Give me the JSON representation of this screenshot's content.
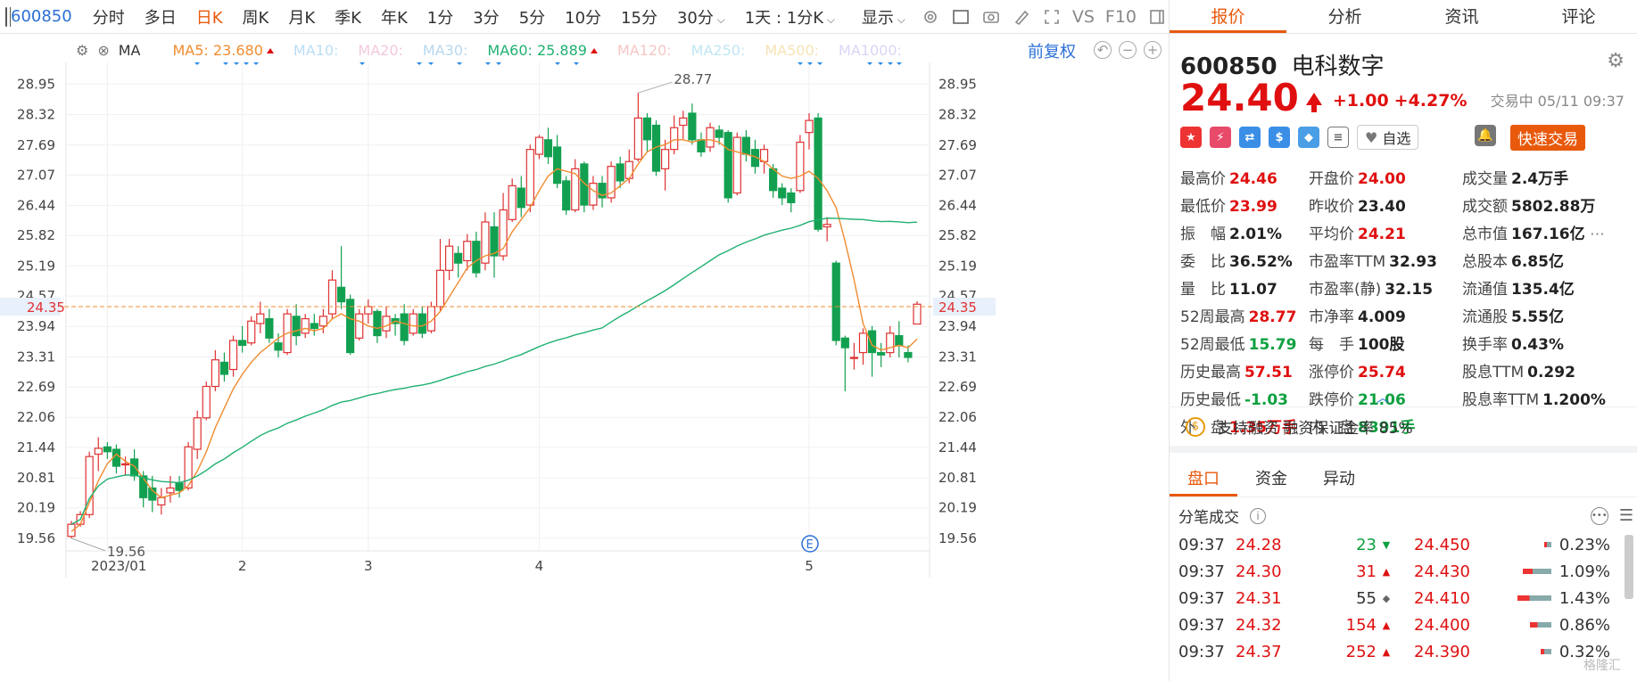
{
  "toolbar": {
    "code": "600850",
    "periods": [
      "分时",
      "多日",
      "日K",
      "周K",
      "月K",
      "季K",
      "年K",
      "1分",
      "3分",
      "5分",
      "10分",
      "15分",
      "30分"
    ],
    "active_period": "日K",
    "range": "1天 : 1分K",
    "display": "显示",
    "vs": "VS",
    "f10": "F10"
  },
  "ma_bar": {
    "label": "MA",
    "items": [
      {
        "name": "MA5:",
        "value": "23.680",
        "color": "#f08c30",
        "up": true
      },
      {
        "name": "MA10:",
        "value": "",
        "color": "#b9ddf4"
      },
      {
        "name": "MA20:",
        "value": "",
        "color": "#f4c8e0"
      },
      {
        "name": "MA30:",
        "value": "",
        "color": "#b8d8ee"
      },
      {
        "name": "MA60:",
        "value": "25.889",
        "color": "#20b070",
        "up": true
      },
      {
        "name": "MA120:",
        "value": "",
        "color": "#f6c6c6"
      },
      {
        "name": "MA250:",
        "value": "",
        "color": "#bfe7f4"
      },
      {
        "name": "MA500:",
        "value": "",
        "color": "#f6e3b4"
      },
      {
        "name": "MA1000:",
        "value": "",
        "color": "#dcd4f4"
      }
    ],
    "adjust": "前复权"
  },
  "chart_data": {
    "type": "candlestick",
    "y_ticks": [
      28.95,
      28.32,
      27.69,
      27.07,
      26.44,
      25.82,
      25.19,
      24.57,
      23.94,
      23.31,
      22.69,
      22.06,
      21.44,
      20.81,
      20.19,
      19.56
    ],
    "ylim": [
      19.3,
      29.4
    ],
    "x_labels": [
      "2023/01",
      "2",
      "3",
      "4",
      "5"
    ],
    "current_price": 24.35,
    "max_label": "28.77",
    "min_label": "19.56",
    "candles": [
      [
        19.6,
        19.85,
        19.56,
        19.92
      ],
      [
        19.85,
        20.05,
        19.8,
        20.12
      ],
      [
        20.05,
        21.25,
        19.98,
        21.35
      ],
      [
        21.3,
        21.42,
        20.95,
        21.65
      ],
      [
        21.45,
        21.35,
        21.2,
        21.55
      ],
      [
        21.4,
        21.05,
        20.9,
        21.5
      ],
      [
        21.1,
        21.1,
        20.85,
        21.25
      ],
      [
        21.2,
        20.85,
        20.75,
        21.4
      ],
      [
        20.85,
        20.4,
        20.2,
        20.95
      ],
      [
        20.6,
        20.35,
        20.1,
        20.85
      ],
      [
        20.25,
        20.4,
        20.05,
        20.6
      ],
      [
        20.5,
        20.6,
        20.3,
        20.85
      ],
      [
        20.7,
        20.55,
        20.4,
        20.85
      ],
      [
        20.6,
        21.45,
        20.55,
        21.55
      ],
      [
        21.4,
        22.05,
        21.2,
        22.2
      ],
      [
        22.05,
        22.7,
        22.0,
        22.8
      ],
      [
        22.7,
        23.25,
        22.6,
        23.45
      ],
      [
        23.2,
        22.95,
        22.8,
        23.4
      ],
      [
        23.05,
        23.65,
        22.9,
        23.75
      ],
      [
        23.65,
        23.55,
        23.4,
        23.95
      ],
      [
        23.6,
        24.05,
        23.55,
        24.15
      ],
      [
        24.0,
        24.2,
        23.8,
        24.45
      ],
      [
        24.1,
        23.7,
        23.6,
        24.3
      ],
      [
        23.6,
        23.45,
        23.3,
        23.8
      ],
      [
        23.4,
        24.2,
        23.35,
        24.3
      ],
      [
        24.15,
        23.75,
        23.55,
        24.4
      ],
      [
        23.8,
        24.1,
        23.7,
        24.2
      ],
      [
        24.0,
        23.9,
        23.75,
        24.2
      ],
      [
        23.95,
        24.15,
        23.8,
        24.3
      ],
      [
        24.2,
        24.9,
        24.1,
        25.1
      ],
      [
        24.75,
        24.45,
        24.3,
        25.6
      ],
      [
        24.5,
        23.4,
        23.35,
        24.6
      ],
      [
        23.7,
        24.2,
        23.65,
        24.3
      ],
      [
        24.2,
        24.35,
        24.0,
        24.5
      ],
      [
        24.25,
        23.75,
        23.6,
        24.3
      ],
      [
        23.85,
        24.15,
        23.7,
        24.35
      ],
      [
        24.1,
        24.0,
        23.75,
        24.2
      ],
      [
        24.2,
        23.65,
        23.55,
        24.4
      ],
      [
        23.8,
        24.2,
        23.75,
        24.3
      ],
      [
        24.2,
        23.8,
        23.7,
        24.35
      ],
      [
        23.85,
        24.35,
        23.8,
        24.45
      ],
      [
        24.35,
        25.1,
        24.25,
        25.75
      ],
      [
        25.1,
        25.6,
        24.9,
        25.75
      ],
      [
        25.45,
        25.25,
        24.95,
        25.6
      ],
      [
        25.3,
        25.7,
        25.1,
        25.85
      ],
      [
        25.7,
        25.05,
        24.95,
        25.9
      ],
      [
        25.25,
        26.1,
        25.1,
        26.3
      ],
      [
        26.0,
        25.4,
        24.95,
        26.3
      ],
      [
        25.4,
        26.35,
        25.3,
        26.7
      ],
      [
        26.15,
        26.85,
        26.1,
        27.0
      ],
      [
        26.8,
        26.4,
        26.2,
        27.05
      ],
      [
        26.45,
        27.6,
        26.3,
        27.7
      ],
      [
        27.5,
        27.85,
        27.4,
        27.9
      ],
      [
        27.8,
        27.45,
        27.3,
        28.05
      ],
      [
        27.65,
        26.9,
        26.8,
        27.9
      ],
      [
        26.95,
        26.35,
        26.25,
        27.05
      ],
      [
        26.35,
        27.2,
        26.3,
        27.4
      ],
      [
        27.3,
        26.45,
        26.3,
        27.35
      ],
      [
        26.45,
        26.9,
        26.35,
        27.05
      ],
      [
        26.9,
        26.6,
        26.4,
        27.05
      ],
      [
        26.6,
        27.25,
        26.5,
        27.35
      ],
      [
        27.3,
        26.95,
        26.8,
        27.45
      ],
      [
        27.0,
        27.35,
        26.9,
        27.6
      ],
      [
        27.4,
        28.25,
        27.35,
        28.77
      ],
      [
        28.25,
        27.8,
        27.55,
        28.35
      ],
      [
        28.1,
        27.15,
        27.05,
        28.2
      ],
      [
        27.2,
        27.6,
        26.75,
        27.8
      ],
      [
        27.6,
        28.05,
        27.5,
        28.3
      ],
      [
        28.1,
        28.25,
        27.8,
        28.4
      ],
      [
        28.35,
        27.8,
        27.7,
        28.55
      ],
      [
        27.8,
        27.55,
        27.45,
        27.95
      ],
      [
        27.65,
        28.05,
        27.55,
        28.15
      ],
      [
        28.0,
        27.85,
        27.7,
        28.1
      ],
      [
        27.95,
        26.6,
        26.5,
        28.0
      ],
      [
        26.7,
        27.85,
        26.65,
        27.95
      ],
      [
        27.85,
        27.5,
        27.35,
        28.0
      ],
      [
        27.6,
        27.25,
        27.1,
        27.8
      ],
      [
        27.35,
        27.6,
        27.1,
        27.7
      ],
      [
        27.2,
        26.75,
        26.6,
        27.3
      ],
      [
        26.8,
        26.6,
        26.45,
        26.9
      ],
      [
        26.7,
        26.5,
        26.3,
        26.8
      ],
      [
        26.75,
        27.75,
        26.7,
        27.9
      ],
      [
        27.95,
        28.2,
        27.6,
        28.35
      ],
      [
        28.25,
        25.95,
        25.9,
        28.35
      ],
      [
        26.0,
        26.05,
        25.7,
        26.2
      ],
      [
        25.25,
        23.65,
        23.55,
        25.3
      ],
      [
        23.7,
        23.5,
        22.6,
        23.75
      ],
      [
        23.3,
        23.3,
        23.05,
        23.6
      ],
      [
        23.4,
        23.8,
        23.15,
        23.9
      ],
      [
        23.85,
        23.4,
        22.9,
        23.95
      ],
      [
        23.4,
        23.35,
        23.1,
        23.6
      ],
      [
        23.4,
        23.8,
        23.3,
        23.95
      ],
      [
        23.75,
        23.55,
        23.3,
        24.05
      ],
      [
        23.4,
        23.3,
        23.2,
        23.55
      ],
      [
        23.99,
        24.4,
        23.99,
        24.46
      ]
    ],
    "ma5": [
      19.7,
      19.85,
      20.3,
      20.75,
      21.1,
      21.3,
      21.15,
      21.05,
      20.8,
      20.55,
      20.4,
      20.45,
      20.5,
      20.65,
      20.95,
      21.35,
      21.85,
      22.25,
      22.65,
      22.95,
      23.2,
      23.4,
      23.55,
      23.7,
      23.8,
      23.85,
      23.9,
      23.85,
      23.9,
      24.1,
      24.2,
      24.1,
      24.05,
      23.95,
      23.9,
      23.95,
      24.05,
      24.0,
      23.95,
      23.95,
      24.05,
      24.25,
      24.55,
      24.85,
      25.15,
      25.3,
      25.4,
      25.45,
      25.55,
      25.9,
      26.15,
      26.4,
      26.75,
      27.05,
      27.2,
      27.15,
      27.1,
      26.9,
      26.75,
      26.65,
      26.7,
      26.85,
      27.0,
      27.3,
      27.55,
      27.65,
      27.7,
      27.8,
      27.8,
      27.75,
      27.8,
      27.8,
      27.75,
      27.6,
      27.55,
      27.5,
      27.45,
      27.35,
      27.2,
      27.05,
      27.0,
      27.05,
      27.15,
      27.0,
      26.75,
      26.4,
      25.7,
      24.9,
      24.0,
      23.55,
      23.45,
      23.5,
      23.55,
      23.5,
      23.68
    ]
  },
  "right": {
    "tabs": [
      "报价",
      "分析",
      "资讯",
      "评论"
    ],
    "active_tab": "报价",
    "code": "600850",
    "name": "电科数字",
    "price": "24.40",
    "change": "+1.00",
    "change_pct": "+4.27%",
    "status": "交易中 05/11 09:37",
    "watch": "自选",
    "quick_trade": "快速交易",
    "stats": [
      [
        "最高价",
        "24.46",
        "r"
      ],
      [
        "开盘价",
        "24.00",
        "r"
      ],
      [
        "成交量",
        "2.4万手",
        "k"
      ],
      [
        "最低价",
        "23.99",
        "r"
      ],
      [
        "昨收价",
        "23.40",
        "k"
      ],
      [
        "成交额",
        "5802.88万",
        "k"
      ],
      [
        "振　幅",
        "2.01%",
        "k"
      ],
      [
        "平均价",
        "24.21",
        "r"
      ],
      [
        "总市值",
        "167.16亿",
        "k"
      ],
      [
        "委　比",
        "36.52%",
        "k"
      ],
      [
        "市盈率TTM",
        "32.93",
        "k"
      ],
      [
        "总股本",
        "6.85亿",
        "k"
      ],
      [
        "量　比",
        "11.07",
        "k"
      ],
      [
        "市盈率(静)",
        "32.15",
        "k"
      ],
      [
        "流通值",
        "135.4亿",
        "k"
      ],
      [
        "52周最高",
        "28.77",
        "r"
      ],
      [
        "市净率",
        "4.009",
        "k"
      ],
      [
        "流通股",
        "5.55亿",
        "k"
      ],
      [
        "52周最低",
        "15.79",
        "g"
      ],
      [
        "每　手",
        "100股",
        "k"
      ],
      [
        "换手率",
        "0.43%",
        "k"
      ],
      [
        "历史最高",
        "57.51",
        "r"
      ],
      [
        "涨停价",
        "25.74",
        "r"
      ],
      [
        "股息TTM",
        "0.292",
        "k"
      ],
      [
        "历史最低",
        "-1.03",
        "g"
      ],
      [
        "跌停价",
        "21.06",
        "g"
      ],
      [
        "股息率TTM",
        "1.200%",
        "k"
      ],
      [
        "外　盘",
        "1.35万手",
        "r"
      ],
      [
        "内　盘",
        "8391手",
        "g"
      ],
      [
        "",
        ""
      ]
    ],
    "rzrq": "支持融资 融资保证金率 85%",
    "subtabs": [
      "盘口",
      "资金",
      "异动"
    ],
    "active_subtab": "盘口",
    "trades_title": "分笔成交",
    "trades": [
      {
        "time": "09:37",
        "price": "24.28",
        "vol": "23",
        "dir": "down",
        "bp": "24.450",
        "pct": "0.23%",
        "bar": 0.05
      },
      {
        "time": "09:37",
        "price": "24.30",
        "vol": "31",
        "dir": "up",
        "bp": "24.430",
        "pct": "1.09%",
        "bar": 0.35
      },
      {
        "time": "09:37",
        "price": "24.31",
        "vol": "55",
        "dir": "flat",
        "bp": "24.410",
        "pct": "1.43%",
        "bar": 0.42
      },
      {
        "time": "09:37",
        "price": "24.32",
        "vol": "154",
        "dir": "up",
        "bp": "24.400",
        "pct": "0.86%",
        "bar": 0.25
      },
      {
        "time": "09:37",
        "price": "24.37",
        "vol": "252",
        "dir": "up",
        "bp": "24.390",
        "pct": "0.32%",
        "bar": 0.1
      }
    ],
    "watermark": "格隆汇"
  }
}
